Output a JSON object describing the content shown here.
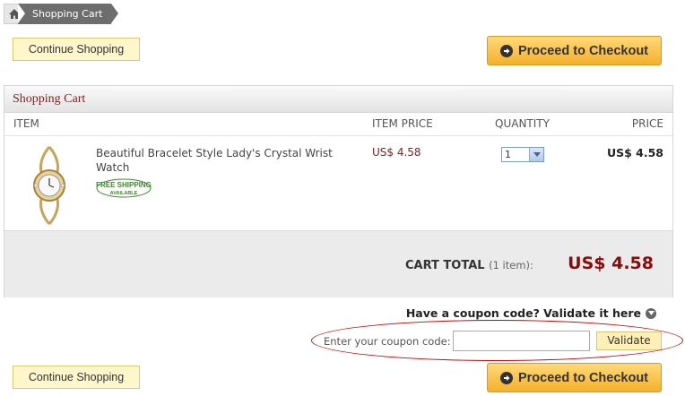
{
  "breadcrumb": {
    "home_icon": "home-icon",
    "current": "Shopping Cart"
  },
  "buttons": {
    "continue_shopping": "Continue Shopping",
    "proceed_checkout": "Proceed to Checkout"
  },
  "cart": {
    "title": "Shopping Cart",
    "columns": {
      "item": "ITEM",
      "item_price": "ITEM PRICE",
      "quantity": "QUANTITY",
      "price": "PRICE"
    },
    "items": [
      {
        "name": "Beautiful Bracelet Style Lady's Crystal Wrist Watch",
        "badge": "FREE SHIPPING AVAILABLE",
        "item_price": "US$ 4.58",
        "quantity": "1",
        "price": "US$ 4.58"
      }
    ],
    "total_label": "CART TOTAL",
    "total_count": "(1 item):",
    "total_amount": "US$ 4.58"
  },
  "coupon": {
    "prompt": "Have a coupon code? Validate it here",
    "label": "Enter your coupon code:",
    "value": "",
    "validate": "Validate"
  },
  "colors": {
    "accent": "#8b1a1a",
    "checkout": "#f5b02a",
    "highlight_ring": "#d40000"
  }
}
